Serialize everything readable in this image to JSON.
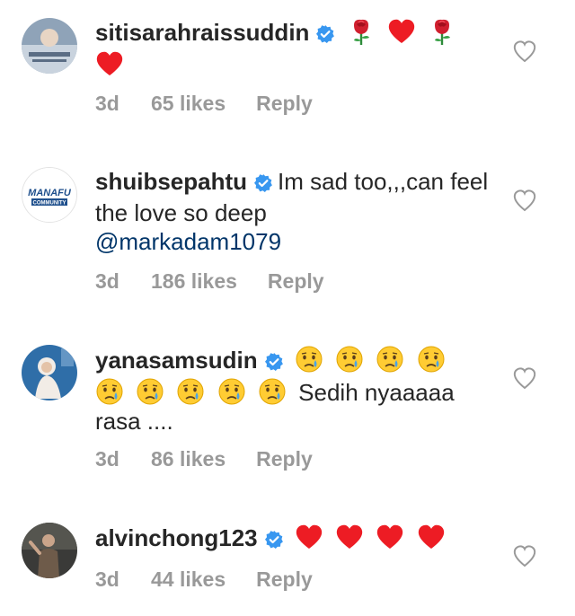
{
  "comments": [
    {
      "username": "sitisarahraissuddin",
      "text": "",
      "mention": "",
      "emojis": [
        "rose",
        "red-heart",
        "rose",
        "red-heart"
      ],
      "time": "3d",
      "likes": "65 likes",
      "reply": "Reply"
    },
    {
      "username": "shuibsepahtu",
      "text": "Im sad too,,,can feel the love so deep",
      "mention": "@markadam1079",
      "emojis": [],
      "time": "3d",
      "likes": "186 likes",
      "reply": "Reply"
    },
    {
      "username": "yanasamsudin",
      "text": "Sedih nyaaaaa rasa ....",
      "mention": "",
      "emojis": [
        "crying-face",
        "crying-face",
        "crying-face",
        "crying-face",
        "crying-face",
        "crying-face",
        "crying-face",
        "crying-face",
        "crying-face"
      ],
      "time": "3d",
      "likes": "86 likes",
      "reply": "Reply"
    },
    {
      "username": "alvinchong123",
      "text": "",
      "mention": "",
      "emojis": [
        "red-heart",
        "red-heart",
        "red-heart",
        "red-heart"
      ],
      "time": "3d",
      "likes": "44 likes",
      "reply": "Reply"
    }
  ],
  "avatar_texts": {
    "shuibsepahtu": "MANAFU COMMUNITY"
  },
  "colors": {
    "username": "#262626",
    "meta": "#999999",
    "mention": "#003569",
    "verified": "#3897f0",
    "heart": "#ed1c24"
  }
}
